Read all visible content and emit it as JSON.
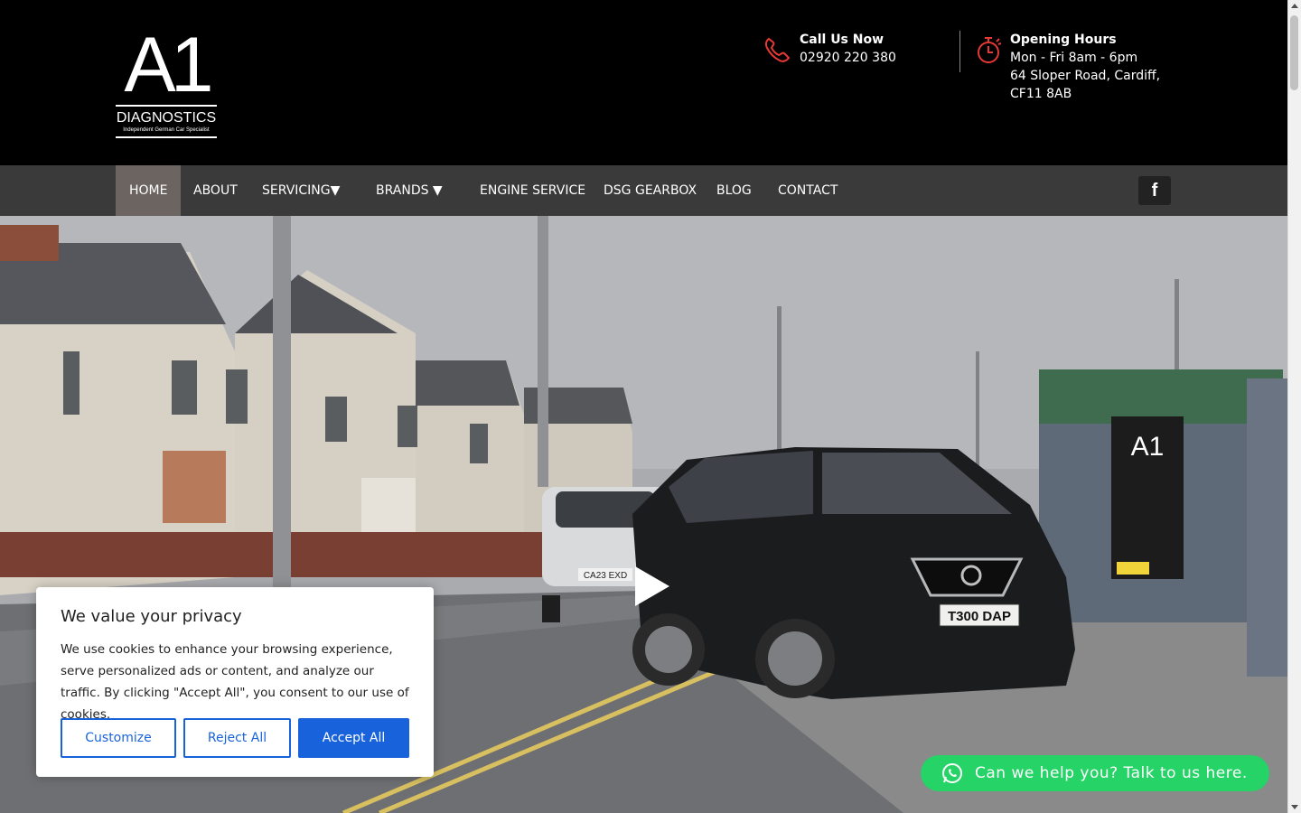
{
  "logo": {
    "mark": "A1",
    "name": "DIAGNOSTICS",
    "tagline": "Independent German Car Specialist"
  },
  "contact": {
    "call_title": "Call Us Now",
    "phone": "02920 220 380",
    "hours_title": "Opening Hours",
    "hours": "Mon - Fri 8am - 6pm",
    "address_line1": "64 Sloper Road, Cardiff,",
    "address_line2": "CF11 8AB"
  },
  "nav": {
    "items": [
      {
        "label": "HOME",
        "active": true
      },
      {
        "label": "ABOUT"
      },
      {
        "label": "SERVICING▼"
      },
      {
        "label": "BRANDS ▼"
      },
      {
        "label": "ENGINE SERVICE"
      },
      {
        "label": "DSG GEARBOX"
      },
      {
        "label": "BLOG"
      },
      {
        "label": "CONTACT"
      }
    ],
    "facebook_icon": "facebook-icon",
    "facebook_label": "f"
  },
  "hero": {
    "play_icon": "play-icon",
    "plate_front": "T300 DAP",
    "plate_back": "CA23 EXD"
  },
  "cookie": {
    "title": "We value your privacy",
    "text": "We use cookies to enhance your browsing experience, serve personalized ads or content, and analyze our traffic. By clicking \"Accept All\", you consent to our use of cookies.",
    "customize": "Customize",
    "reject": "Reject All",
    "accept": "Accept All"
  },
  "whatsapp": {
    "label": "Can we help you? Talk to us here.",
    "icon": "whatsapp-icon"
  },
  "colors": {
    "accent_red": "#e53935",
    "nav_bg": "#3a3a3a",
    "nav_active": "#6b6461",
    "cookie_blue": "#1863dc",
    "whatsapp_green": "#25d366"
  }
}
